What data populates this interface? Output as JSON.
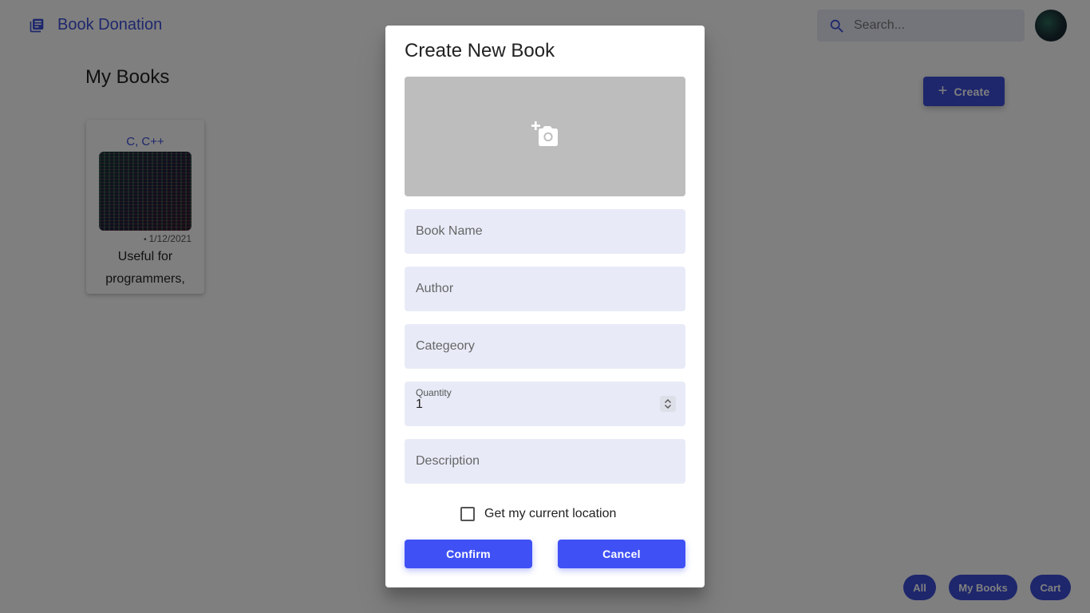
{
  "app": {
    "title": "Book Donation",
    "search_placeholder": "Search..."
  },
  "page": {
    "title": "My Books",
    "create_label": "Create"
  },
  "books": [
    {
      "title": "C, C++",
      "date": "1/12/2021",
      "description": "Useful for programmers,"
    }
  ],
  "bottom_nav": {
    "all": "All",
    "my_books": "My Books",
    "cart": "Cart"
  },
  "dialog": {
    "title": "Create New Book",
    "book_name_placeholder": "Book Name",
    "author_placeholder": "Author",
    "category_placeholder": "Categeory",
    "quantity_label": "Quantity",
    "quantity_value": "1",
    "description_placeholder": "Description",
    "location_label": "Get my current location",
    "location_checked": false,
    "confirm_label": "Confirm",
    "cancel_label": "Cancel"
  },
  "icons": {
    "brand": "library-books-icon",
    "search": "search-icon",
    "add_photo": "add-a-photo-icon",
    "create": "plus-icon",
    "spinner": "stepper-arrows-icon"
  },
  "colors": {
    "primary": "#3d4ed8",
    "button": "#3f51f5",
    "field_background": "#e8ebf7",
    "backdrop": "rgba(0,0,0,0.5)"
  }
}
